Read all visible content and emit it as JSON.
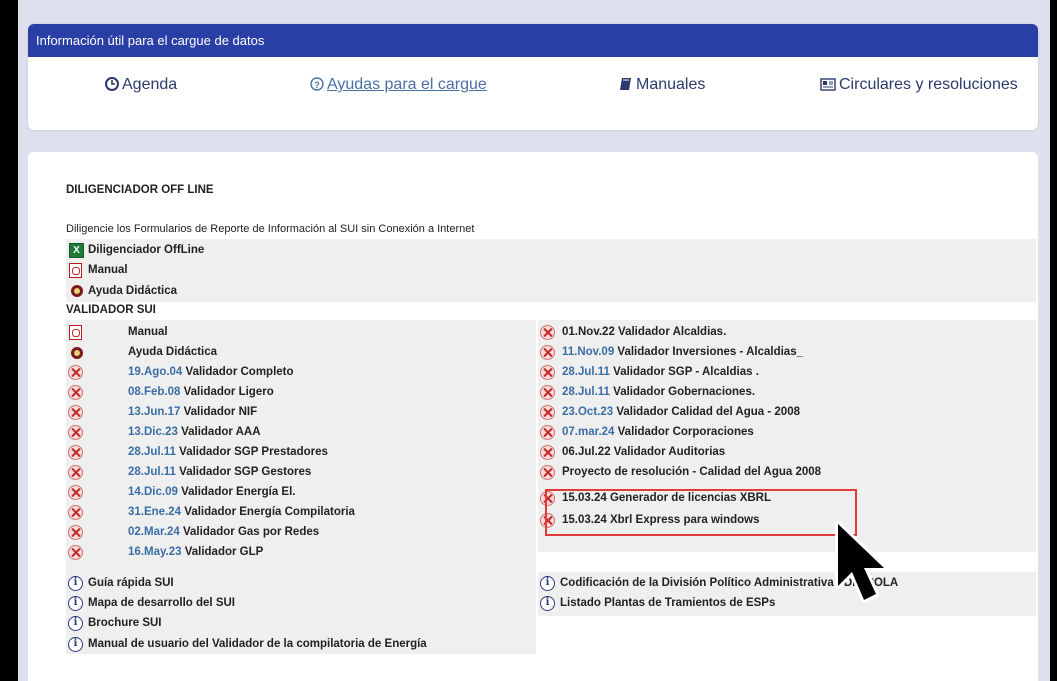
{
  "info": {
    "header": "Información útil para el cargue de datos",
    "links": [
      "Agenda",
      "Ayudas para el cargue",
      "Manuales",
      "Circulares y resoluciones"
    ]
  },
  "offline": {
    "title": "DILIGENCIADOR OFF LINE",
    "description": "Diligencie los Formularios de Reporte de Información al SUI sin Conexión a Internet",
    "items": [
      "Diligenciador OffLine",
      "Manual",
      "Ayuda Didáctica"
    ]
  },
  "validador": {
    "title": "VALIDADOR SUI",
    "left": [
      {
        "date": "",
        "label": "Manual",
        "icon": "pdf-icon"
      },
      {
        "date": "",
        "label": "Ayuda Didáctica",
        "icon": "help-icon"
      },
      {
        "date": "19.Ago.04",
        "label": "Validador Completo"
      },
      {
        "date": "08.Feb.08",
        "label": "Validador Ligero"
      },
      {
        "date": "13.Jun.17",
        "label": "Validador NIF"
      },
      {
        "date": "13.Dic.23",
        "label": "Validador AAA"
      },
      {
        "date": "28.Jul.11",
        "label": "Validador SGP Prestadores"
      },
      {
        "date": "28.Jul.11",
        "label": "Validador SGP Gestores"
      },
      {
        "date": "14.Dic.09",
        "label": "Validador Energía El."
      },
      {
        "date": "31.Ene.24",
        "label": "Validador Energía Compilatoria"
      },
      {
        "date": "02.Mar.24",
        "label": "Validador Gas por Redes"
      },
      {
        "date": "16.May.23",
        "label": "Validador GLP"
      }
    ],
    "right": [
      {
        "date": "",
        "label": "01.Nov.22 Validador Alcaldias."
      },
      {
        "date": "11.Nov.09",
        "label": "Validador Inversiones - Alcaldias_"
      },
      {
        "date": "28.Jul.11",
        "label": "Validador SGP - Alcaldias ."
      },
      {
        "date": "28.Jul.11",
        "label": "Validador Gobernaciones."
      },
      {
        "date": "23.Oct.23",
        "label": "Validador Calidad del Agua - 2008"
      },
      {
        "date": "07.mar.24",
        "label": "Validador Corporaciones"
      },
      {
        "date": "",
        "label": "06.Jul.22 Validador Auditorias"
      },
      {
        "date": "",
        "label": "Proyecto de resolución - Calidad del Agua 2008"
      },
      {
        "date": "",
        "label": "15.03.24 Generador de licencias XBRL"
      },
      {
        "date": "",
        "label": "15.03.24 Xbrl Express para windows"
      }
    ]
  },
  "guides": {
    "left": [
      "Guía rápida SUI",
      "Mapa de desarrollo del SUI",
      "Brochure SUI",
      "Manual de usuario del Validador de la compilatoria de Energía"
    ],
    "right": [
      "Codificación de la División Político Administrativa - DIVIPOLA",
      "Listado Plantas de Tramientos de ESPs"
    ]
  },
  "colors": {
    "header": "#2a3fa6",
    "highlight": "#e23a3a",
    "date": "#3a6ea5"
  }
}
